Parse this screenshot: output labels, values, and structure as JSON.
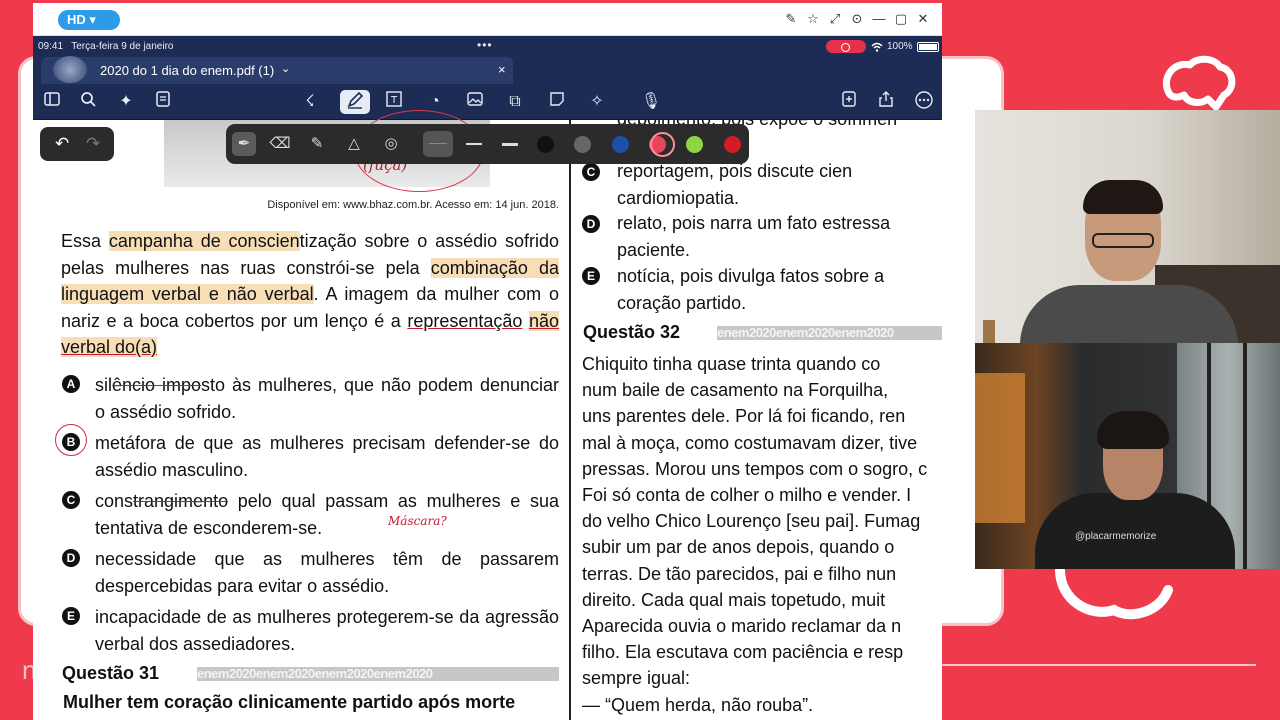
{
  "window": {
    "quality_label": "HD ▾",
    "controls": [
      "✎",
      "☆",
      "⤢",
      "⊙",
      "—",
      "▢",
      "✕"
    ]
  },
  "status_bar": {
    "time": "09:41",
    "date": "Terça-feira 9 de janeiro",
    "battery": "100%",
    "wifi_icon": "wifi-icon",
    "dots": "•••"
  },
  "tab": {
    "title": "2020 do 1 dia do enem.pdf (1)",
    "chevron": "⌄",
    "close": "×"
  },
  "toolbar": {
    "left_icons": [
      "sidebar-icon",
      "search-icon",
      "sparkle-icon",
      "document-icon"
    ],
    "center_icons": [
      "lasso-icon",
      "pen-icon",
      "text-box-icon",
      "shapes-icon",
      "image-icon",
      "elements-icon",
      "sticky-note-icon",
      "laser-icon",
      "microphone-icon"
    ],
    "right_icons": [
      "add-page-icon",
      "share-icon",
      "more-icon"
    ]
  },
  "pen_toolbar": {
    "colors": [
      "#111111",
      "#666666",
      "#1f4fa8",
      "#e8465b",
      "#8fd444",
      "#d41c24"
    ],
    "selected_color": "#e8465b"
  },
  "left_page": {
    "image_caption_handwriting": "(fuça)",
    "credit": "Disponível em: www.bhaz.com.br. Acesso em: 14 jun. 2018.",
    "intro_parts": {
      "p1": "Essa ",
      "p2": "campanha de conscien",
      "p3": "tização sobre o assédio sofrido pelas mulheres nas ruas constrói-se pela ",
      "p4": "combinação da linguagem verbal e não verbal",
      "p5": ". A imagem da mulher com o nariz e a boca cobertos por um lenço é a ",
      "p6": "representação",
      "p7": " ",
      "p8": "não verbal do(a)"
    },
    "options": [
      {
        "letter": "A",
        "pre": "sil",
        "strike": "êncio impo",
        "post": "sto às mulheres, que não podem denunciar o assédio sofrido."
      },
      {
        "letter": "B",
        "pre": "metáfora de que as mulheres precisam defender-se do assédio masculino.",
        "strike": "",
        "post": ""
      },
      {
        "letter": "C",
        "pre": "cons",
        "strike": "trangimento",
        "post": " pelo qual passam as mulheres e sua tentativa de esconderem-se."
      },
      {
        "letter": "D",
        "pre": "necessidade que as mulheres têm de passarem despercebidas para evitar o assédio.",
        "strike": "",
        "post": ""
      },
      {
        "letter": "E",
        "pre": "incapacidade de as mulheres protegerem-se da agressão verbal dos assediadores.",
        "strike": "",
        "post": ""
      }
    ],
    "annotation": "Máscara?",
    "q31_label": "Questão 31",
    "enem_band": "enem2020enem2020enem2020enem2020",
    "q31_title": "Mulher tem coração clinicamente partido após morte"
  },
  "right_page": {
    "top_line": "depoimento, pois expõe o sofrimen",
    "options": [
      {
        "letter": "C",
        "lines": [
          "reportagem,    pois    discute    cien",
          "cardiomiopatia."
        ]
      },
      {
        "letter": "D",
        "lines": [
          "relato, pois narra um fato estressa",
          "paciente."
        ]
      },
      {
        "letter": "E",
        "lines": [
          "notícia, pois divulga fatos sobre a",
          "coração partido."
        ]
      }
    ],
    "q32_label": "Questão 32",
    "enem_band": "enem2020enem2020enem2020",
    "text_lines": [
      "     Chiquito tinha quase trinta quando co",
      "num baile de casamento na Forquilha,",
      "uns parentes dele. Por lá foi ficando, ren",
      "mal à moça, como costumavam dizer, tive",
      "pressas. Morou uns tempos com o sogro, c",
      "Foi só conta de colher o milho e vender. I",
      "do velho Chico Lourenço [seu pai]. Fumag",
      "subir um par de anos depois, quando o",
      "terras. De tão parecidos, pai e filho nun",
      "direito. Cada qual mais topetudo, muit",
      "Aparecida ouvia o marido reclamar da n",
      "filho. Ela escutava com paciência e resp",
      "sempre igual:",
      "     — “Quem herda, não rouba”."
    ]
  },
  "webcam_bottom": {
    "shirt_text": "@placarmemorize"
  }
}
